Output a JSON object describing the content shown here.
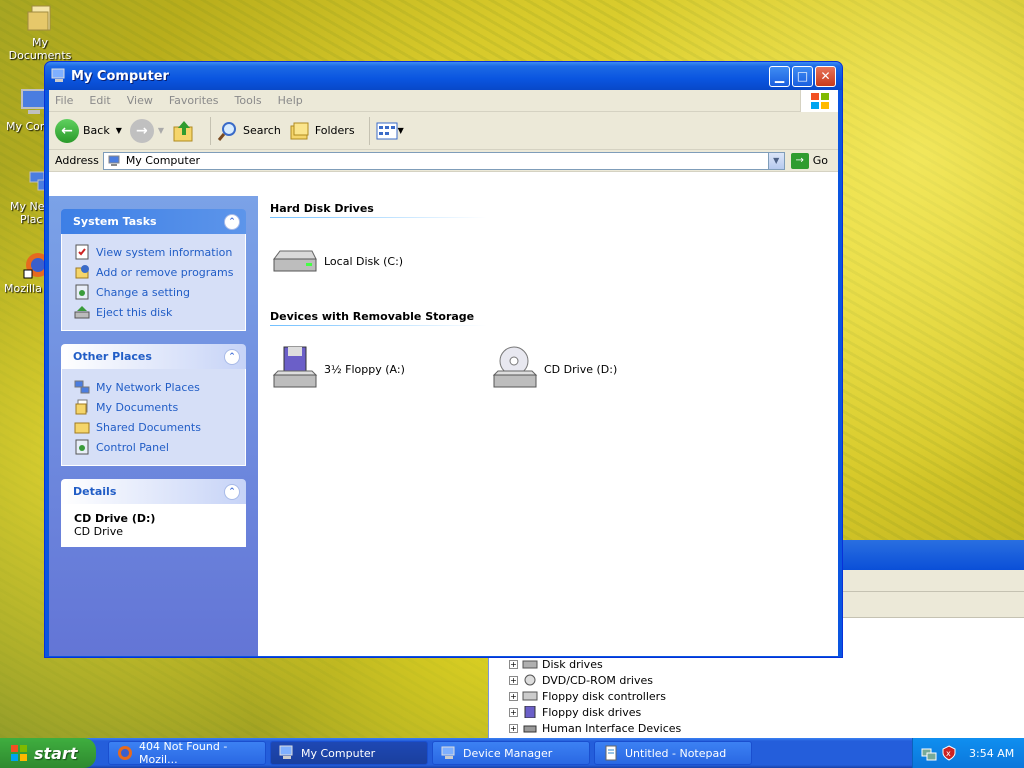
{
  "desktop": {
    "icons": [
      {
        "label": "My Documents",
        "icon": "my-documents-icon"
      },
      {
        "label": "My Com",
        "icon": "my-computer-icon"
      },
      {
        "label": "My Net",
        "label2": "Plac",
        "icon": "network-places-icon"
      },
      {
        "label": "Mozilla F",
        "icon": "firefox-icon"
      }
    ]
  },
  "device_manager": {
    "tree": [
      "Disk drives",
      "DVD/CD-ROM drives",
      "Floppy disk controllers",
      "Floppy disk drives",
      "Human Interface Devices"
    ]
  },
  "window": {
    "title": "My Computer",
    "menu": [
      "File",
      "Edit",
      "View",
      "Favorites",
      "Tools",
      "Help"
    ],
    "toolbar": {
      "back": "Back",
      "search": "Search",
      "folders": "Folders"
    },
    "address": {
      "label": "Address",
      "value": "My Computer",
      "go": "Go"
    },
    "sidebar": {
      "system_tasks": {
        "title": "System Tasks",
        "items": [
          "View system information",
          "Add or remove programs",
          "Change a setting",
          "Eject this disk"
        ]
      },
      "other_places": {
        "title": "Other Places",
        "items": [
          "My Network Places",
          "My Documents",
          "Shared Documents",
          "Control Panel"
        ]
      },
      "details": {
        "title": "Details",
        "name": "CD Drive (D:)",
        "type": "CD Drive"
      }
    },
    "content": {
      "hard_disk_title": "Hard Disk Drives",
      "hard_disks": [
        "Local Disk (C:)"
      ],
      "removable_title": "Devices with Removable Storage",
      "removable": [
        "3½ Floppy (A:)",
        "CD Drive (D:)"
      ]
    }
  },
  "taskbar": {
    "start": "start",
    "buttons": [
      "404 Not Found - Mozil...",
      "My Computer",
      "Device Manager",
      "Untitled - Notepad"
    ],
    "clock": "3:54 AM"
  },
  "colors": {
    "title_blue": "#0a55e0",
    "taskbar_blue": "#245edb",
    "start_green": "#3fae3f",
    "link_blue": "#215dc6"
  }
}
